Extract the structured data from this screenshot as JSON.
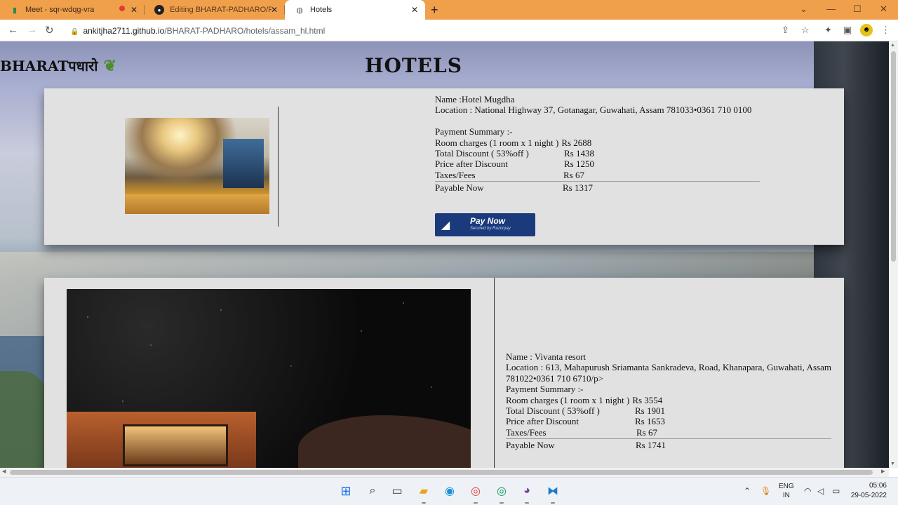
{
  "browser": {
    "tabs": [
      {
        "title": "Meet - sqr-wdqg-vra",
        "icon": "meet-icon"
      },
      {
        "title": "Editing BHARAT-PADHARO/REA",
        "icon": "github-icon"
      },
      {
        "title": "Hotels",
        "icon": "globe-icon"
      }
    ],
    "url_host": "ankitjha2711.github.io",
    "url_path": "/BHARAT-PADHARO/hotels/assam_hl.html"
  },
  "page": {
    "logo_text": "BHARATपधारो",
    "heading": "HOTELS"
  },
  "hotels": [
    {
      "name": "Name :Hotel Mugdha",
      "location": "Location : National Highway 37, Gotanagar, Guwahati, Assam 781033•0361 710 0100",
      "summary_title": "Payment Summary :-",
      "rows": [
        {
          "label": "Room charges (1 room x 1 night )",
          "value": "Rs 2688"
        },
        {
          "label": "Total Discount ( 53%off )",
          "value": "Rs 1438"
        },
        {
          "label": "Price after Discount",
          "value": "Rs 1250"
        },
        {
          "label": "Taxes/Fees",
          "value": "Rs 67"
        }
      ],
      "payable_label": "Payable Now",
      "payable_value": "Rs 1317",
      "pay_button": {
        "main": "Pay Now",
        "sub": "Secured by Razorpay"
      }
    },
    {
      "name": "Name : Vivanta resort",
      "location": "Location : 613, Mahapurush Sriamanta Sankradeva, Road, Khanapara, Guwahati, Assam 781022•0361 710 6710/p>",
      "summary_title": "Payment Summary :-",
      "rows": [
        {
          "label": "Room charges (1 room x 1 night )",
          "value": "Rs 3554"
        },
        {
          "label": "Total Discount ( 53%off )",
          "value": "Rs 1901"
        },
        {
          "label": "Price after Discount",
          "value": "Rs 1653"
        },
        {
          "label": "Taxes/Fees",
          "value": "Rs 67"
        }
      ],
      "payable_label": "Payable Now",
      "payable_value": "Rs 1741"
    }
  ],
  "taskbar": {
    "lang_top": "ENG",
    "lang_bottom": "IN",
    "time": "05:06",
    "date": "29-05-2022"
  }
}
